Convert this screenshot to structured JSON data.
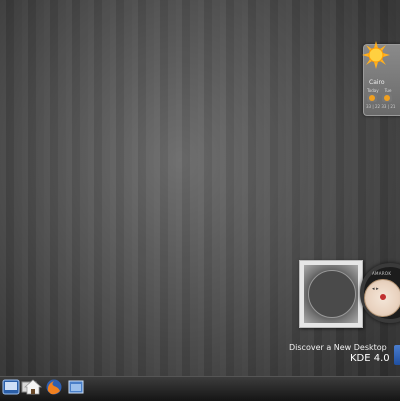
{
  "desktop": {
    "tagline": "Discover a New Desktop",
    "version": "KDE 4.0"
  },
  "weather": {
    "city": "Cairo",
    "days": [
      "Today",
      "Tue"
    ],
    "temps": "33 | 22  33 | 21",
    "icon": "sun-icon"
  },
  "player": {
    "brand": "AMAROK",
    "controls": "◂  ▸"
  },
  "panel": {
    "icons": [
      "kde-menu-icon",
      "desktop-icon",
      "home-icon",
      "firefox-icon",
      "window-icon"
    ]
  }
}
